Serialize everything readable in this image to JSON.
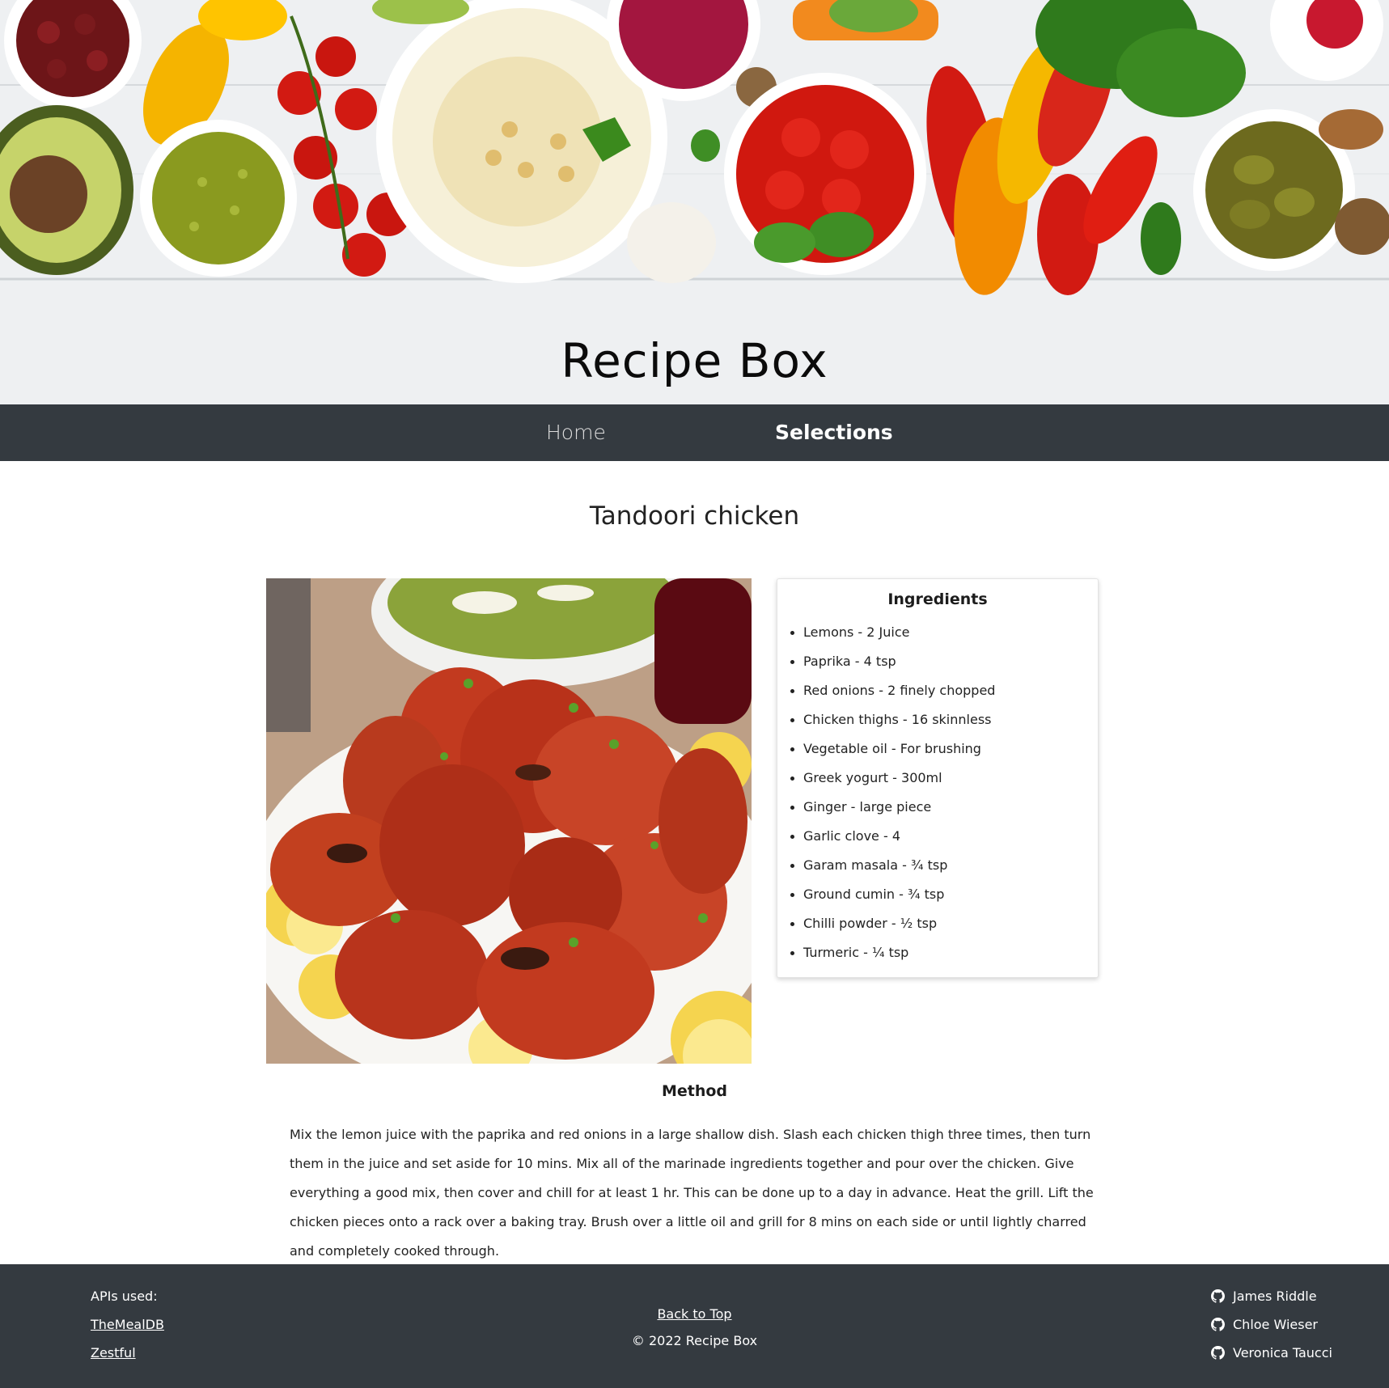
{
  "site": {
    "title": "Recipe Box"
  },
  "nav": {
    "home_label": "Home",
    "selections_label": "Selections"
  },
  "recipe": {
    "title": "Tandoori chicken",
    "ingredients_heading": "Ingredients",
    "ingredients": [
      "Lemons - 2 Juice",
      "Paprika - 4 tsp",
      "Red onions - 2 finely chopped",
      "Chicken thighs - 16 skinnless",
      "Vegetable oil - For brushing",
      "Greek yogurt - 300ml",
      "Ginger - large piece",
      "Garlic clove - 4",
      "Garam masala - ¾ tsp",
      "Ground cumin - ¾ tsp",
      "Chilli powder - ½ tsp",
      "Turmeric - ¼ tsp"
    ],
    "method_heading": "Method",
    "method_text": "Mix the lemon juice with the paprika and red onions in a large shallow dish. Slash each chicken thigh three times, then turn them in the juice and set aside for 10 mins. Mix all of the marinade ingredients together and pour over the chicken. Give everything a good mix, then cover and chill for at least 1 hr. This can be done up to a day in advance. Heat the grill. Lift the chicken pieces onto a rack over a baking tray. Brush over a little oil and grill for 8 mins on each side or until lightly charred and completely cooked through."
  },
  "footer": {
    "apis_label": "APIs used:",
    "api_links": [
      "TheMealDB",
      "Zestful"
    ],
    "back_to_top": "Back to Top",
    "copyright": "© 2022 Recipe Box",
    "authors": [
      "James Riddle",
      "Chloe Wieser",
      "Veronica Taucci"
    ]
  },
  "colors": {
    "nav_bg": "#343a40",
    "footer_bg": "#343a40",
    "text": "#212529"
  },
  "icons": {
    "author_icon": "github-icon"
  }
}
